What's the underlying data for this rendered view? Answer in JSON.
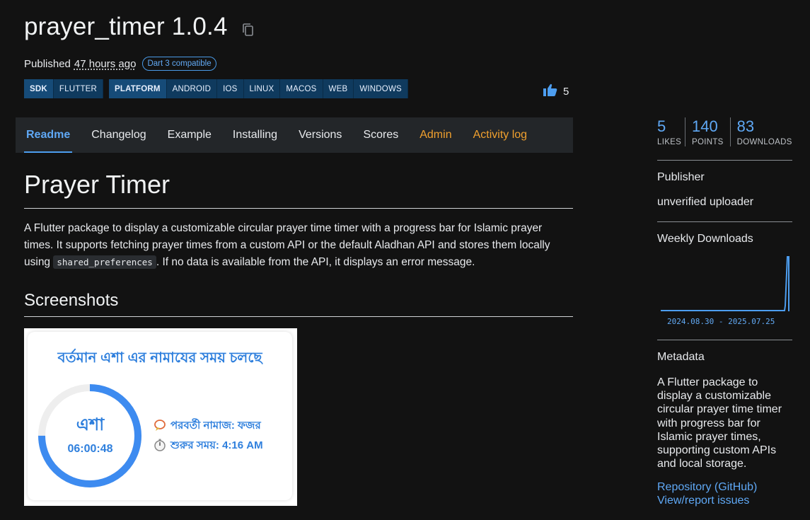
{
  "package": {
    "title": "prayer_timer 1.0.4",
    "published_prefix": "Published",
    "published_ago": "47 hours ago",
    "dart_badge": "Dart 3 compatible"
  },
  "tags": {
    "sdk": [
      "SDK",
      "FLUTTER"
    ],
    "platform": [
      "PLATFORM",
      "ANDROID",
      "IOS",
      "LINUX",
      "MACOS",
      "WEB",
      "WINDOWS"
    ]
  },
  "likes_inline": "5",
  "tabs": [
    {
      "label": "Readme",
      "active": true
    },
    {
      "label": "Changelog"
    },
    {
      "label": "Example"
    },
    {
      "label": "Installing"
    },
    {
      "label": "Versions"
    },
    {
      "label": "Scores"
    },
    {
      "label": "Admin",
      "admin": true
    },
    {
      "label": "Activity log",
      "admin": true
    }
  ],
  "readme": {
    "title": "Prayer Timer",
    "desc_before": "A Flutter package to display a customizable circular prayer time timer with a progress bar for Islamic prayer times. It supports fetching prayer times from a custom API or the default Aladhan API and stores them locally using ",
    "desc_code": "shared_preferences",
    "desc_after": ". If no data is available from the API, it displays an error message.",
    "screenshots_heading": "Screenshots"
  },
  "screenshot": {
    "heading": "বর্তমান এশা এর নামাযের সময় চলছে",
    "prayer_name": "এশা",
    "countdown": "06:00:48",
    "progress": 0.75,
    "next_label": "পরবর্তী নামাজ: ফজর",
    "start_label": "শুরুর সময়: 4:16 AM",
    "accent": "#2e7fdd"
  },
  "stats": [
    {
      "value": "5",
      "label": "LIKES"
    },
    {
      "value": "140",
      "label": "POINTS"
    },
    {
      "value": "83",
      "label": "DOWNLOADS"
    }
  ],
  "sidebar": {
    "publisher_heading": "Publisher",
    "publisher_value": "unverified uploader",
    "weekly_heading": "Weekly Downloads",
    "weekly_range": "2024.08.30 - 2025.07.25",
    "metadata_heading": "Metadata",
    "metadata_desc": "A Flutter package to display a customizable circular prayer time timer with progress bar for Islamic prayer times, supporting custom APIs and local storage.",
    "repo_link": "Repository (GitHub)",
    "issues_link": "View/report issues"
  },
  "colors": {
    "background": "#121212",
    "link": "#5fa8f5",
    "admin": "#f0a02e",
    "tag_bg": "#0f3a5e"
  }
}
